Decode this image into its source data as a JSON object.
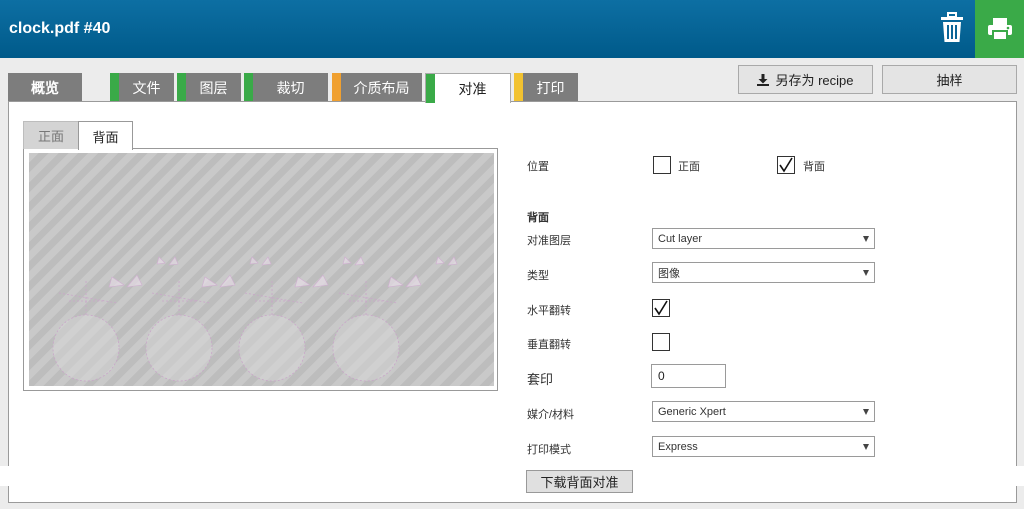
{
  "header": {
    "title": "clock.pdf #40",
    "trash_icon": "trash-icon",
    "print_icon": "printer-icon",
    "print_color": "#3aaa48"
  },
  "tabs": [
    {
      "label": "概览",
      "color": ""
    },
    {
      "label": "文件",
      "color": "#3aaa48"
    },
    {
      "label": "图层",
      "color": "#3aaa48"
    },
    {
      "label": "裁切",
      "color": "#3aaa48"
    },
    {
      "label": "介质布局",
      "color": "#f0a030"
    },
    {
      "label": "对准",
      "color": "#3aaa48"
    },
    {
      "label": "打印",
      "color": "#f2c230"
    }
  ],
  "actions": {
    "save_recipe": "另存为 recipe",
    "sample": "抽样"
  },
  "sides": {
    "front": "正面",
    "back": "背面"
  },
  "form": {
    "position_label": "位置",
    "front_label": "正面",
    "back_label": "背面",
    "front_checked": false,
    "back_checked": true,
    "section_title": "背面",
    "layer_label": "对准图层",
    "layer_value": "Cut layer",
    "type_label": "类型",
    "type_value": "图像",
    "hflip_label": "水平翻转",
    "hflip_checked": true,
    "vflip_label": "垂直翻转",
    "vflip_checked": false,
    "overprint_label": "套印",
    "overprint_value": "0",
    "media_label": "媒介/材料",
    "media_value": "Generic Xpert",
    "mode_label": "打印模式",
    "mode_value": "Express",
    "download_label": "下载背面对准"
  }
}
